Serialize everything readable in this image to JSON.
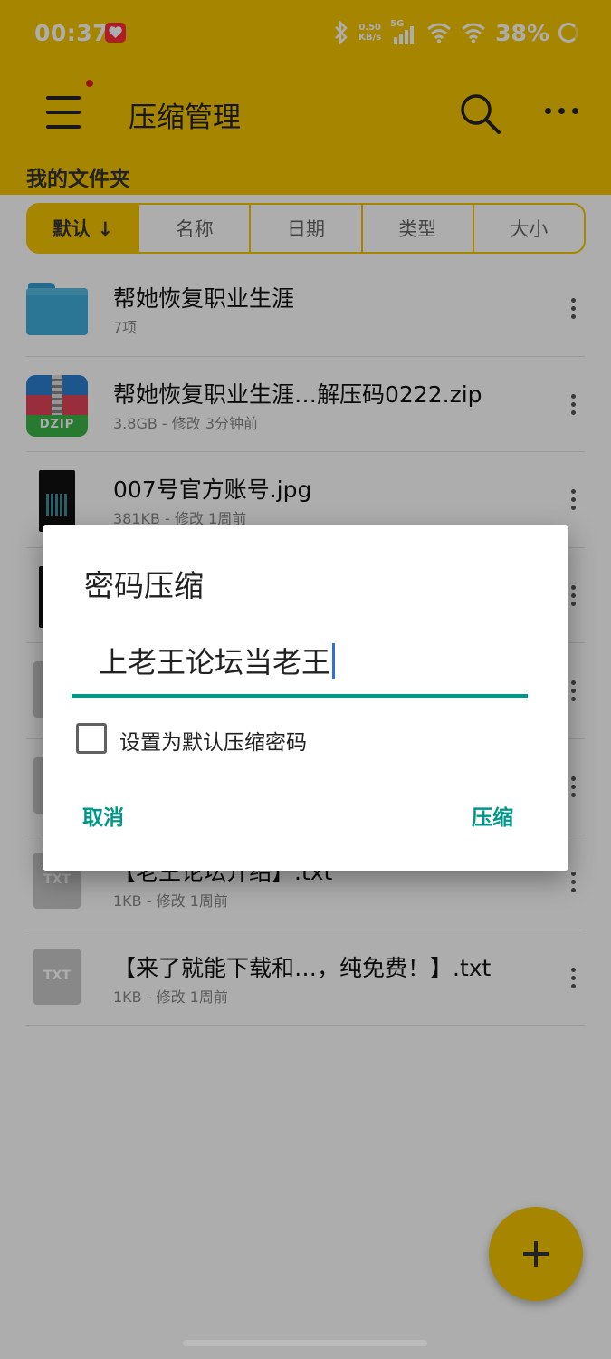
{
  "status_bar": {
    "time": "00:37",
    "net_speed_value": "0.50",
    "net_speed_unit": "KB/s",
    "network": "5G",
    "battery": "38%"
  },
  "toolbar": {
    "title": "压缩管理",
    "menu_icon": "hamburger-menu-icon",
    "search_icon": "search-icon",
    "more_icon": "more-horizontal-icon"
  },
  "breadcrumb": "我的文件夹",
  "sort_tabs": [
    "默认 ↓",
    "名称",
    "日期",
    "类型",
    "大小"
  ],
  "files": [
    {
      "name": "帮她恢复职业生涯",
      "meta": "7项",
      "icon": "folder-icon"
    },
    {
      "name": "帮她恢复职业生涯…解压码0222.zip",
      "meta": "3.8GB - 修改 3分钟前",
      "icon": "zip-icon",
      "icon_label": "DZIP"
    },
    {
      "name": "007号官方账号.jpg",
      "meta": "381KB - 修改 1周前",
      "icon": "image-icon"
    },
    {
      "name": "",
      "meta": "",
      "icon": "image-icon"
    },
    {
      "name": "",
      "meta": "",
      "icon": "txt-icon"
    },
    {
      "name": "",
      "meta": "",
      "icon": "txt-icon"
    },
    {
      "name": "【老王论坛介绍】.txt",
      "meta": "1KB - 修改 1周前",
      "icon": "txt-icon",
      "icon_label": "TXT"
    },
    {
      "name": "【来了就能下载和…，纯免费！】.txt",
      "meta": "1KB - 修改 1周前",
      "icon": "txt-icon",
      "icon_label": "TXT"
    }
  ],
  "dialog": {
    "title": "密码压缩",
    "password_value": "上老王论坛当老王",
    "checkbox_label": "设置为默认压缩密码",
    "checkbox_checked": false,
    "cancel_label": "取消",
    "confirm_label": "压缩"
  },
  "colors": {
    "accent": "#f5c400",
    "dialog_action": "#009688"
  }
}
